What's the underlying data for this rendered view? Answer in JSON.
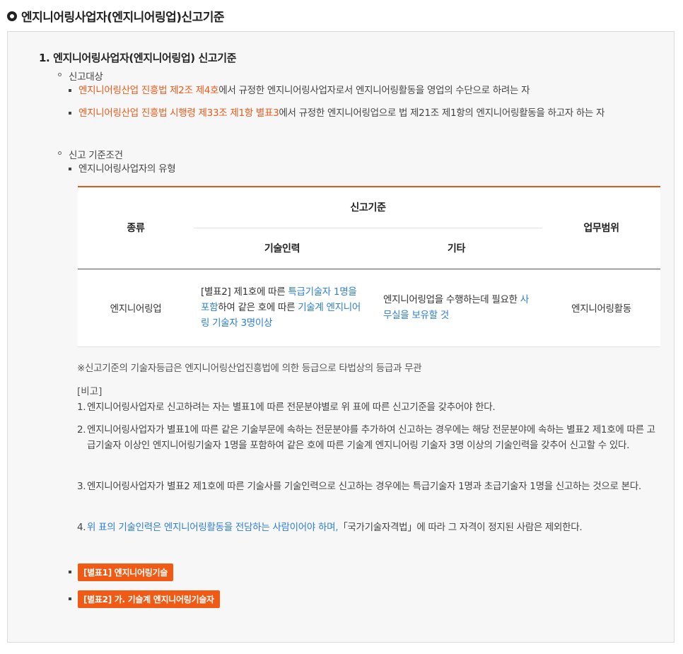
{
  "page_title": "엔지니어링사업자(엔지니어링업)신고기준",
  "section": {
    "title": "1. 엔지니어링사업자(엔지니어링업) 신고기준",
    "target": {
      "label": "신고대상",
      "items": [
        {
          "link": "엔지니어링산업 진흥법 제2조 제4호",
          "text": "에서 규정한 엔지니어링사업자로서 엔지니어링활동을 영업의 수단으로 하려는 자"
        },
        {
          "link": "엔지니어링산업 진흥법 시행령 제33조 제1항 별표3",
          "text": "에서 규정한 엔지니어링업으로 법 제21조 제1항의 엔지니어링활동을 하고자 하는 자"
        }
      ]
    },
    "criteria": {
      "label": "신고 기준조건",
      "type_label": "엔지니어링사업자의 유형"
    }
  },
  "table": {
    "col_kind": "종류",
    "col_criteria": "신고기준",
    "col_tech": "기술인력",
    "col_etc": "기타",
    "col_scope": "업무범위",
    "row": {
      "kind": "엔지니어링업",
      "tech_a": "[별표2] 제1호에 따른 ",
      "tech_b": "특급기술자 1명을 포함",
      "tech_c": "하여 같은 호에 따른 ",
      "tech_d": "기술계 엔지니어링 기술자 3명이상",
      "etc_a": "엔지니어링업을 수행하는데 필요한 ",
      "etc_b": "사무실을 보유할 것",
      "scope": "엔지니어링활동"
    }
  },
  "note": "※신고기준의 기술자등급은 엔지니어링산업진흥법에 의한 등급으로 타법상의 등급과 무관",
  "remarks": {
    "head": "[비고]",
    "items": [
      {
        "num": "1.",
        "text": "엔지니어링사업자로 신고하려는 자는 별표1에 따른 전문분야별로 위 표에 따른 신고기준을 갖추어야 한다."
      },
      {
        "num": "2.",
        "text": "엔지니어링사업자가 별표1에 따른 같은 기술부문에 속하는 전문분야를 추가하여 신고하는 경우에는 해당 전문분야에 속하는 별표2 제1호에 따른 고급기술자 이상인 엔지니어링기술자 1명을 포함하여 같은 호에 따른 기술계 엔지니어링 기술자 3명 이상의 기술인력을 갖추어 신고할 수 있다."
      },
      {
        "num": "3.",
        "text": "엔지니어링사업자가 별표2 제1호에 따른 기술사를 기술인력으로 신고하는 경우에는 특급기술자 1명과 초급기술자 1명을 신고하는 것으로 본다."
      },
      {
        "num": "4.",
        "blue": "위 표의 기술인력은 엔지니어링활동을 전담하는 사람이어야 하며,",
        "text": "「국가기술자격법」에 따라 그 자격이 정지된 사람은 제외한다."
      }
    ]
  },
  "buttons": {
    "annex1": "[별표1] 엔지니어링기술",
    "annex2": "[별표2] 가. 기술계 엔지니어링기술자"
  },
  "colors": {
    "accent": "#f05a14",
    "link_orange": "#ee5a1a",
    "link_blue": "#2d7fd8"
  }
}
